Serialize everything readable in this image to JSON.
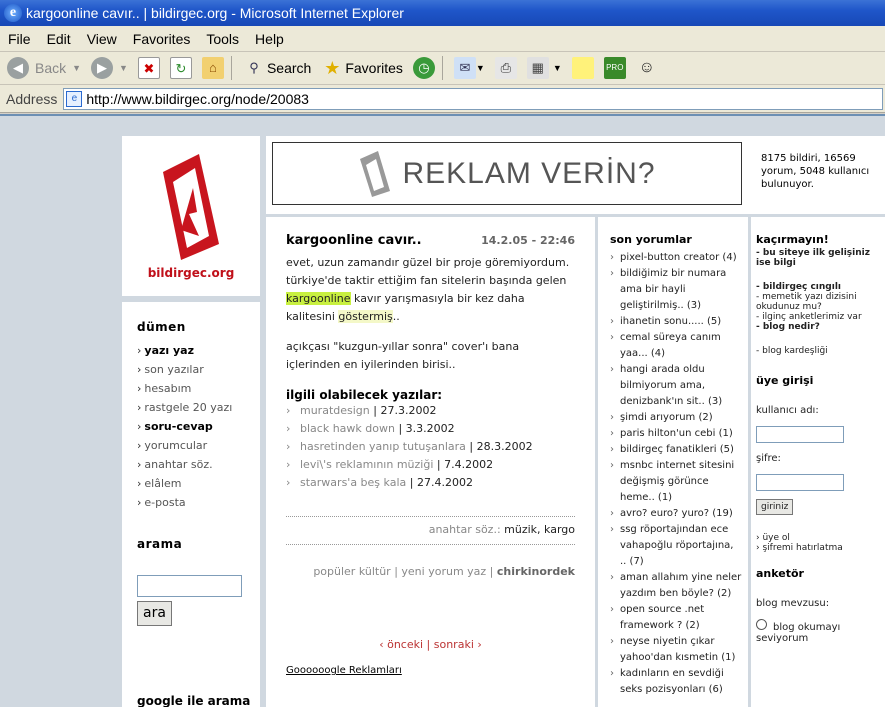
{
  "window": {
    "title": "kargoonline cavır.. | bildirgec.org - Microsoft Internet Explorer",
    "icon": "ie-icon"
  },
  "menu": [
    "File",
    "Edit",
    "View",
    "Favorites",
    "Tools",
    "Help"
  ],
  "toolbar": {
    "back": "Back",
    "search": "Search",
    "favorites": "Favorites"
  },
  "address": {
    "label": "Address",
    "url": "http://www.bildirgec.org/node/20083"
  },
  "logo": {
    "text": "bildirgec.org"
  },
  "nav": {
    "title": "dümen",
    "items": [
      "yazı yaz",
      "son yazılar",
      "hesabım",
      "rastgele 20 yazı",
      "soru-cevap",
      "yorumcular",
      "anahtar söz.",
      "elâlem",
      "e-posta"
    ],
    "search_title": "arama",
    "search_button": "ara",
    "google_title": "google ile arama"
  },
  "header": {
    "ad_text": "REKLAM VERİN?",
    "stats": "8175 bildiri, 16569 yorum, 5048 kullanıcı bulunuyor."
  },
  "post": {
    "title": "kargoonline cavır..",
    "date": "14.2.05 - 22:46",
    "p1a": "evet, uzun zamandır güzel bir proje göremiyordum. türkiye'de taktir ettiğim fan sitelerin başında gelen ",
    "p1hl": "kargoonline",
    "p1b": " kavır yarışmasıyla bir kez daha kalitesini ",
    "p1hl2": "göstermiş",
    "p1c": "..",
    "p2": "açıkçası \"kuzgun-yıllar sonra\" cover'ı bana içlerinden en iyilerinden birisi..",
    "related_title": "ilgili olabilecek yazılar:",
    "related": [
      {
        "title": "muratdesign",
        "date": "27.3.2002"
      },
      {
        "title": "black hawk down",
        "date": "3.3.2002"
      },
      {
        "title": "hasretinden yanıp tutuşanlara",
        "date": "28.3.2002"
      },
      {
        "title": "levi\\'s reklamının müziği",
        "date": "7.4.2002"
      },
      {
        "title": "starwars'a beş kala",
        "date": "27.4.2002"
      }
    ],
    "tags_label": "anahtar söz.:",
    "tags": "müzik, kargo",
    "footer_cat": "popüler kültür",
    "footer_comment": "yeni yorum yaz",
    "footer_author": "chirkinordek",
    "prev": "‹ önceki",
    "next": "sonraki ›",
    "google_ads": "Goooooogle Reklamları"
  },
  "comments": {
    "title": "son yorumlar",
    "items": [
      "pixel-button creator (4)",
      "bildiğimiz bir numara ama bir hayli geliştirilmiş.. (3)",
      "ihanetin sonu..... (5)",
      "cemal süreya canım yaa... (4)",
      "hangi arada oldu bilmiyorum ama, denizbank'ın sit.. (3)",
      "şimdi arıyorum (2)",
      "paris hilton'un cebi (1)",
      "bildirgeç fanatikleri (5)",
      "msnbc internet sitesini değişmiş görünce heme.. (1)",
      "avro? euro? yuro? (19)",
      "ssg röportajından ece vahapoğlu röportajına, .. (7)",
      "aman allahım yine neler yazdım ben böyle? (2)",
      "open source .net framework ? (2)",
      "neyse niyetin çıkar yahoo'dan kısmetin (1)",
      "kadınların en sevdiği seks pozisyonları (6)"
    ]
  },
  "right": {
    "title": "kaçırmayın!",
    "l1": "- bu siteye ilk gelişiniz ise bilgi",
    "l2": "- bildirgeç cıngılı",
    "l3": "- memetik yazı dizisini okudunuz mu?",
    "l4": "- ilginç anketlerimiz var",
    "l5": "- blog nedir?",
    "l6": "- blog kardeşliği",
    "login_title": "üye girişi",
    "username": "kullanıcı adı:",
    "password": "şifre:",
    "login_btn": "giriniz",
    "register": "› üye ol",
    "forgot": "› şifremi hatırlatma",
    "poll_title": "anketör",
    "poll_q": "blog mevzusu:",
    "poll_opt": "blog okumayı seviyorum"
  }
}
